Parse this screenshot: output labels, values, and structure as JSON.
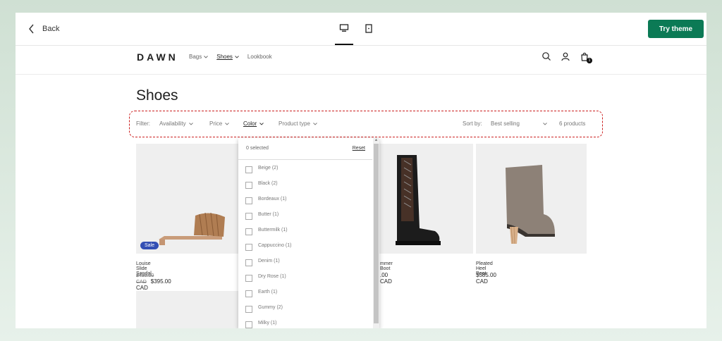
{
  "toolbar": {
    "back_label": "Back",
    "try_button": "Try theme"
  },
  "store": {
    "logo": "DAWN",
    "nav": [
      "Bags",
      "Shoes",
      "Lookbook"
    ],
    "cart_count": "1"
  },
  "page": {
    "title": "Shoes"
  },
  "filters": {
    "filter_label": "Filter:",
    "availability": "Availability",
    "price": "Price",
    "color": "Color",
    "product_type": "Product type",
    "sort_label": "Sort by:",
    "sort_value": "Best selling",
    "count": "6 products"
  },
  "products": [
    {
      "name": "Louise Slide Sandal",
      "old_price": "$430.00 CAD",
      "price": "$395.00 CAD",
      "badge": "Sale"
    },
    {
      "name": "mmer Boot",
      "price": ".00 CAD"
    },
    {
      "name": "Pleated Heel Boot",
      "price": "$585.00 CAD"
    }
  ],
  "color_dropdown": {
    "selected": "0 selected",
    "reset": "Reset",
    "options": [
      "Beige (2)",
      "Black (2)",
      "Bordeaux (1)",
      "Butter (1)",
      "Buttermilk (1)",
      "Cappuccino (1)",
      "Denim (1)",
      "Dry Rose (1)",
      "Earth (1)",
      "Gummy (2)",
      "Milky (1)"
    ]
  },
  "colors": {
    "accent": "#0b7a55",
    "sale_badge": "#334fb4",
    "highlight_border": "#cc1f1f"
  }
}
